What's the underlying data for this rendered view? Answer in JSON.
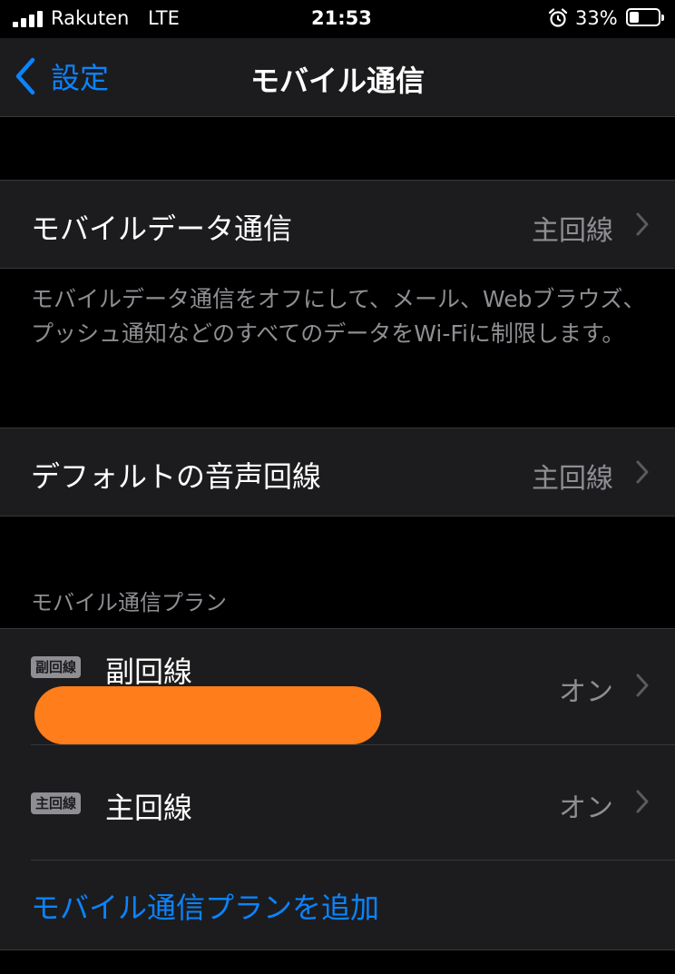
{
  "status": {
    "carrier": "Rakuten",
    "network": "LTE",
    "time": "21:53",
    "battery_percent": "33%",
    "battery_level": 0.33,
    "icons": [
      "signal-icon",
      "alarm-icon",
      "battery-icon"
    ]
  },
  "nav": {
    "back_label": "設定",
    "title": "モバイル通信"
  },
  "cellular_data": {
    "label": "モバイルデータ通信",
    "value": "主回線",
    "footer": "モバイルデータ通信をオフにして、メール、Webブラウズ、プッシュ通知などのすべてのデータをWi-Fiに制限します。"
  },
  "default_voice": {
    "label": "デフォルトの音声回線",
    "value": "主回線"
  },
  "plans": {
    "header": "モバイル通信プラン",
    "items": [
      {
        "tag": "副回線",
        "name": "副回線",
        "status": "オン"
      },
      {
        "tag": "主回線",
        "name": "主回線",
        "status": "オン"
      }
    ],
    "add_label": "モバイル通信プランを追加"
  },
  "colors": {
    "accent": "#0a84ff",
    "background": "#000000",
    "cell": "#1c1c1e",
    "secondary_text": "#8e8e93",
    "redaction": "#ff7d1a"
  }
}
